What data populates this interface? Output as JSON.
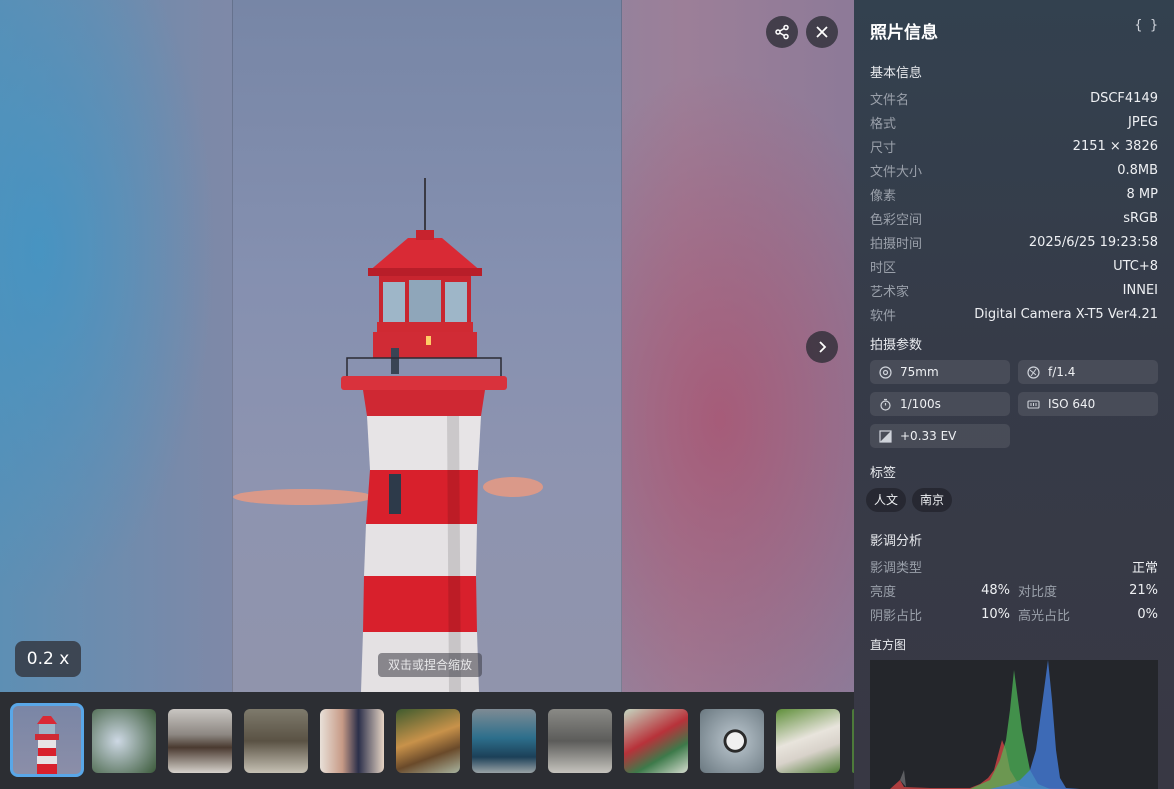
{
  "viewer": {
    "zoom_hint": "双击或捏合缩放",
    "zoom_level": "0.2 x",
    "share_icon": "share-icon",
    "close_icon": "close-icon",
    "next_icon": "chevron-right-icon"
  },
  "thumbnails": [
    {
      "subject": "lighthouse",
      "active": true
    },
    {
      "subject": "wire-dome"
    },
    {
      "subject": "bear"
    },
    {
      "subject": "bears"
    },
    {
      "subject": "girls"
    },
    {
      "subject": "tiger"
    },
    {
      "subject": "peacock"
    },
    {
      "subject": "bird"
    },
    {
      "subject": "parrot"
    },
    {
      "subject": "panda"
    },
    {
      "subject": "egret"
    }
  ],
  "panel": {
    "title": "照片信息",
    "json_icon": "{ }",
    "basic": {
      "title": "基本信息",
      "rows": [
        {
          "key": "文件名",
          "value": "DSCF4149"
        },
        {
          "key": "格式",
          "value": "JPEG"
        },
        {
          "key": "尺寸",
          "value": "2151 × 3826"
        },
        {
          "key": "文件大小",
          "value": "0.8MB"
        },
        {
          "key": "像素",
          "value": "8 MP"
        },
        {
          "key": "色彩空间",
          "value": "sRGB"
        },
        {
          "key": "拍摄时间",
          "value": "2025/6/25 19:23:58"
        },
        {
          "key": "时区",
          "value": "UTC+8"
        },
        {
          "key": "艺术家",
          "value": "INNEI"
        },
        {
          "key": "软件",
          "value": "Digital Camera X-T5 Ver4.21"
        }
      ]
    },
    "params": {
      "title": "拍摄参数",
      "focal": "75mm",
      "aperture": "f/1.4",
      "shutter": "1/100s",
      "iso": "ISO 640",
      "exposure": "+0.33 EV"
    },
    "tags": {
      "title": "标签",
      "items": [
        "人文",
        "南京"
      ]
    },
    "tone": {
      "title": "影调分析",
      "type_label": "影调类型",
      "type_value": "正常",
      "brightness_label": "亮度",
      "brightness_value": "48%",
      "contrast_label": "对比度",
      "contrast_value": "21%",
      "shadow_label": "阴影占比",
      "shadow_value": "10%",
      "highlight_label": "高光占比",
      "highlight_value": "0%"
    },
    "histogram": {
      "title": "直方图"
    }
  }
}
